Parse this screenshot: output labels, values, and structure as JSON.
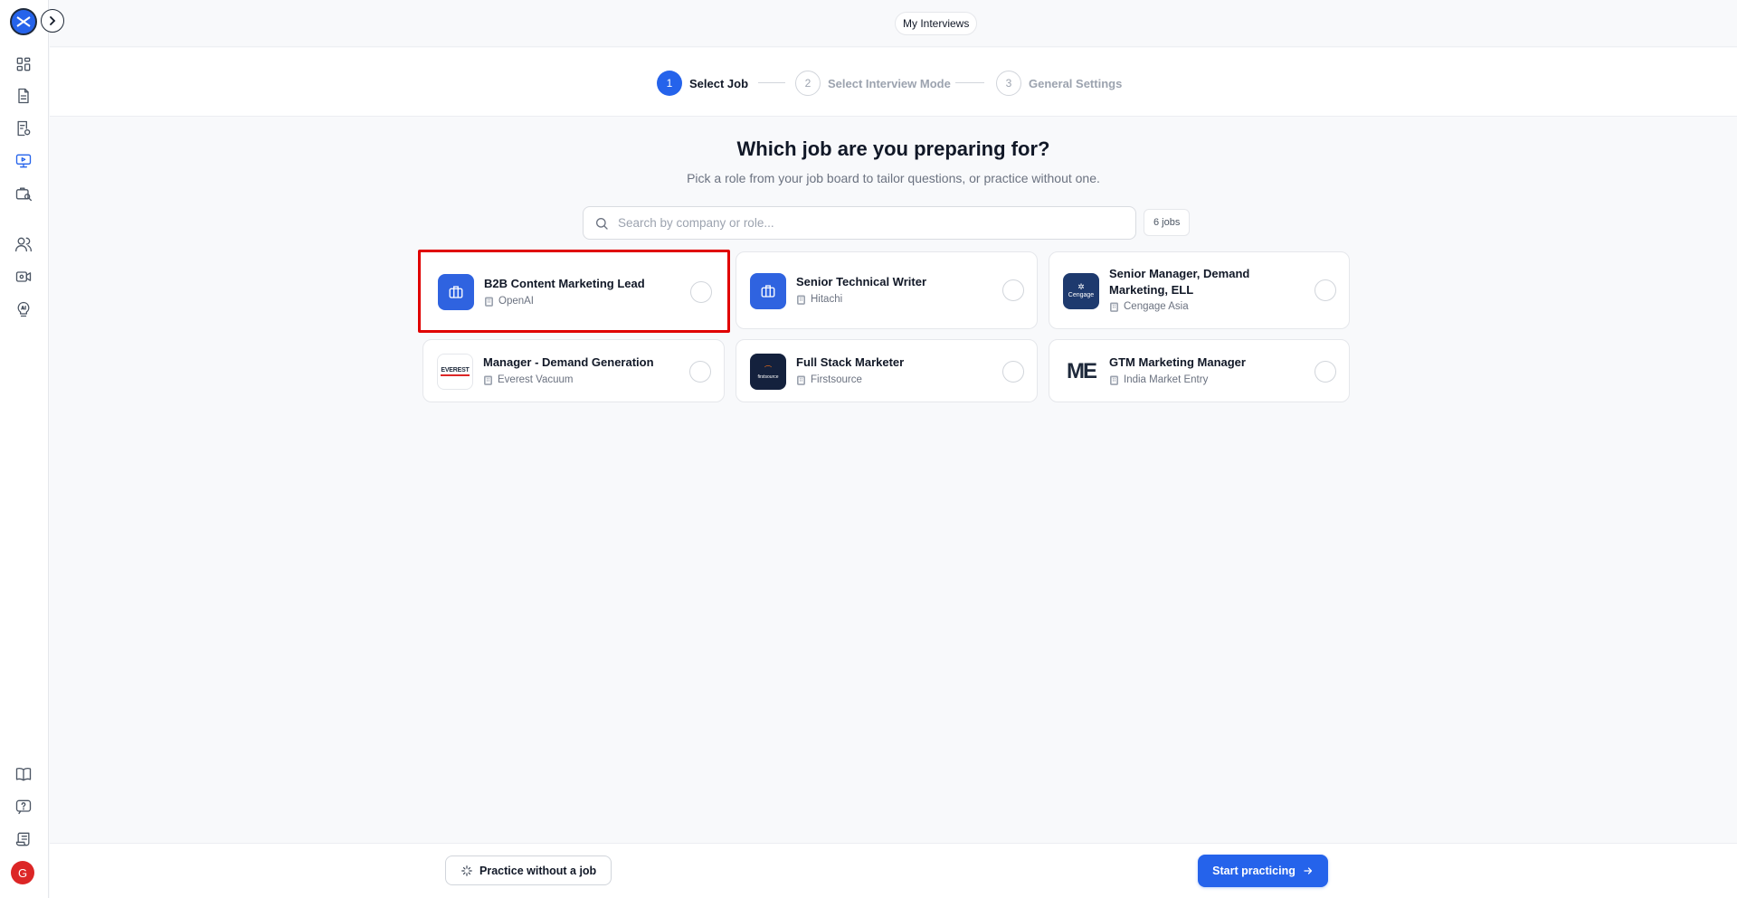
{
  "sidebar": {
    "logo_text": "✕",
    "nav_items": [
      {
        "icon": "dashboard-icon"
      },
      {
        "icon": "document-icon"
      },
      {
        "icon": "resume-icon"
      },
      {
        "icon": "interview-icon",
        "active": true
      },
      {
        "icon": "job-search-icon"
      },
      {
        "icon": "users-icon"
      },
      {
        "icon": "video-icon"
      },
      {
        "icon": "ai-bulb-icon"
      }
    ],
    "bottom_items": [
      {
        "icon": "book-icon"
      },
      {
        "icon": "help-icon"
      },
      {
        "icon": "scroll-icon"
      }
    ],
    "avatar_initial": "G"
  },
  "header": {
    "my_interviews_label": "My Interviews"
  },
  "stepper": {
    "steps": [
      {
        "number": "1",
        "label": "Select Job"
      },
      {
        "number": "2",
        "label": "Select Interview Mode"
      },
      {
        "number": "3",
        "label": "General Settings"
      }
    ]
  },
  "main": {
    "title": "Which job are you preparing for?",
    "subtitle": "Pick a role from your job board to tailor questions, or practice without one.",
    "search_placeholder": "Search by company or role...",
    "jobs_count": "6 jobs",
    "jobs": [
      {
        "title": "B2B Content Marketing Lead",
        "company": "OpenAI",
        "logo": "briefcase"
      },
      {
        "title": "Senior Technical Writer",
        "company": "Hitachi",
        "logo": "briefcase"
      },
      {
        "title": "Senior Manager, Demand Marketing, ELL",
        "company": "Cengage Asia",
        "logo_text": "Cengage"
      },
      {
        "title": "Manager - Demand Generation",
        "company": "Everest Vacuum",
        "logo_text": "EVEREST"
      },
      {
        "title": "Full Stack Marketer",
        "company": "Firstsource",
        "logo_text": "firstsource"
      },
      {
        "title": "GTM Marketing Manager",
        "company": "India Market Entry",
        "logo_text": "ME"
      }
    ]
  },
  "footer": {
    "practice_without_job_label": "Practice without a job",
    "start_practicing_label": "Start practicing"
  },
  "colors": {
    "accent": "#2563eb",
    "highlight": "#e00000"
  }
}
